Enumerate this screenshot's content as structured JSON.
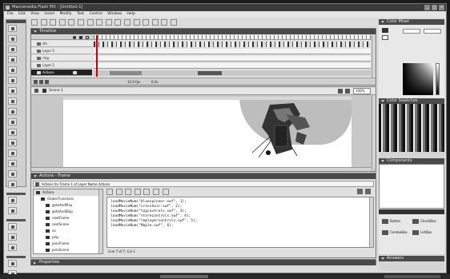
{
  "app": {
    "title": "Macromedia Flash MX - [Untitled-1]",
    "window_controls": [
      "_",
      "□",
      "×"
    ]
  },
  "menubar": {
    "items": [
      "File",
      "Edit",
      "View",
      "Insert",
      "Modify",
      "Text",
      "Control",
      "Window",
      "Help"
    ]
  },
  "timeline": {
    "panel_title": "Timeline",
    "layers": [
      {
        "name": "sfx"
      },
      {
        "name": "Layer 5"
      },
      {
        "name": "ring"
      },
      {
        "name": "Layer 2"
      },
      {
        "name": "Actions"
      }
    ],
    "frame_rate": "12.0 fps",
    "time": "0.0s"
  },
  "stage": {
    "scene_label": "Scene 1",
    "zoom": "100%"
  },
  "actions": {
    "panel_title": "Actions - Frame",
    "hint": "Actions for Frame 1 of Layer Name Actions",
    "tree_title": "Actions",
    "tree_items": [
      "Global Functions",
      "gotoAndPlay",
      "gotoAndStop",
      "nextFrame",
      "nextScene",
      "on",
      "play",
      "prevFrame",
      "prevScene",
      "stop"
    ],
    "code_lines": [
      "loadMovieNum(\"bluespinner.swf\", 1);",
      "loadMovieNum(\"crosshair.swf\", 2);",
      "loadMovieNum(\"topcontrols.swf\", 3);",
      "loadMovieNum(\"storecontrols.swf\", 4);",
      "loadMovieNum(\"rmplayercontrols.swf\", 5);",
      "loadMovieNum(\"Maple.swf\", 6);"
    ],
    "status": "Line 7 of 7, Col 1"
  },
  "properties": {
    "panel_title": "Properties"
  },
  "right_panels": {
    "color_mixer_title": "Color Mixer",
    "color_swatches_title": "Color Swatches",
    "components_title": "Components",
    "library_buttons": [
      "Button",
      "CheckBox",
      "ComboBox",
      "ListBox"
    ],
    "answers_title": "Answers"
  },
  "colors": {
    "panel_header": "#4a4a4a",
    "toolbar_bg": "#dcdcdc",
    "stage_bg": "#ffffff",
    "work_area": "#c8c8c8"
  }
}
